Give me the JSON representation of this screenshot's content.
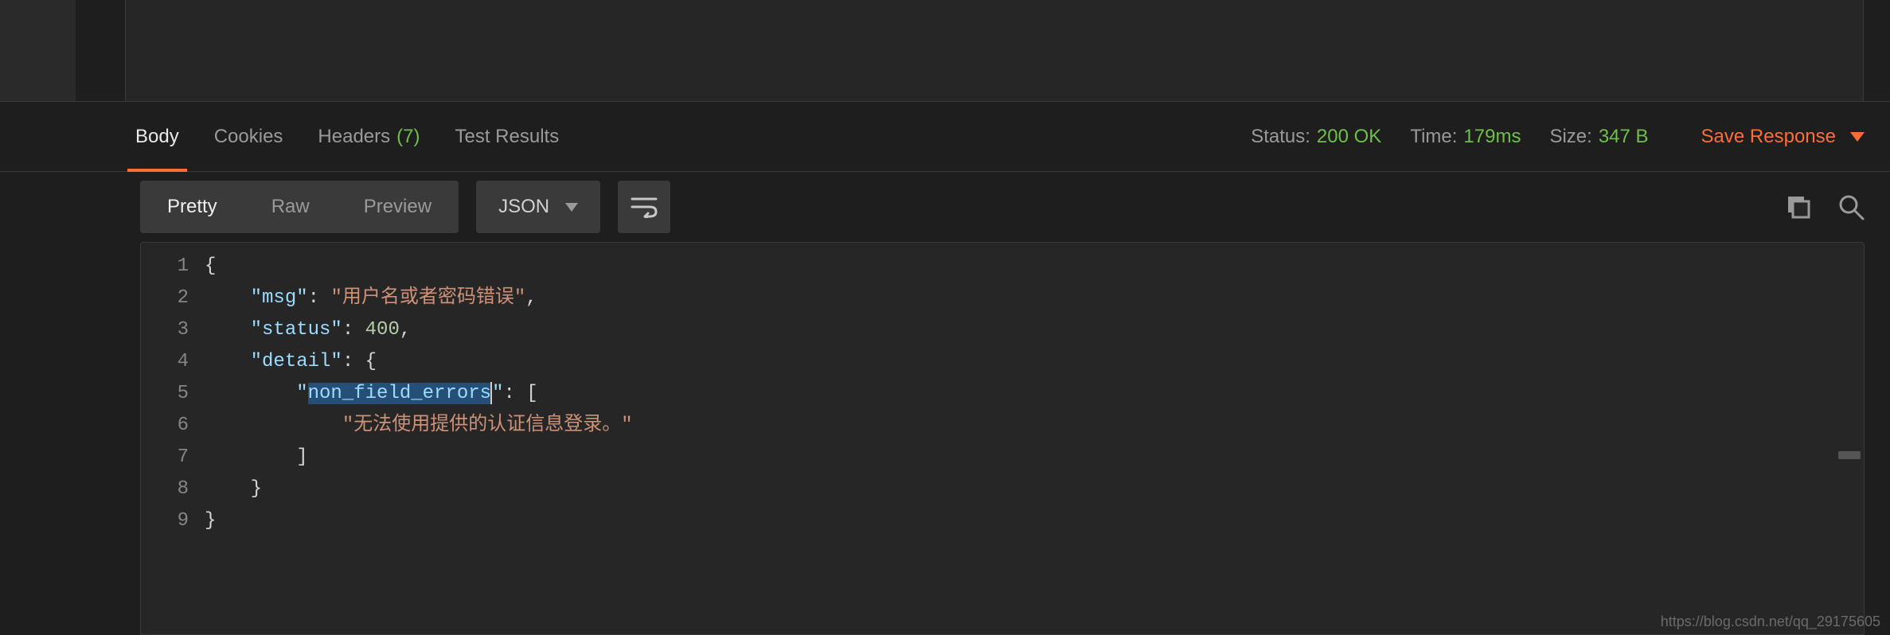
{
  "tabs": {
    "body": "Body",
    "cookies": "Cookies",
    "headers": "Headers",
    "headers_count": "(7)",
    "test_results": "Test Results"
  },
  "stats": {
    "status_label": "Status:",
    "status_value": "200 OK",
    "time_label": "Time:",
    "time_value": "179ms",
    "size_label": "Size:",
    "size_value": "347 B"
  },
  "save_response": "Save Response",
  "view_modes": {
    "pretty": "Pretty",
    "raw": "Raw",
    "preview": "Preview"
  },
  "format_select": "JSON",
  "code": {
    "lines": [
      "1",
      "2",
      "3",
      "4",
      "5",
      "6",
      "7",
      "8",
      "9"
    ],
    "l1": "{",
    "l2_key": "\"msg\"",
    "l2_colon": ": ",
    "l2_val": "\"用户名或者密码错误\"",
    "l2_end": ",",
    "l3_key": "\"status\"",
    "l3_colon": ": ",
    "l3_val": "400",
    "l3_end": ",",
    "l4_key": "\"detail\"",
    "l4_colon": ": ",
    "l4_val": "{",
    "l5_q1": "\"",
    "l5_sel": "non_field_errors",
    "l5_q2": "\"",
    "l5_rest": ": [",
    "l6_val": "\"无法使用提供的认证信息登录。\"",
    "l7": "]",
    "l8": "}",
    "l9": "}"
  },
  "watermark": "https://blog.csdn.net/qq_29175605"
}
